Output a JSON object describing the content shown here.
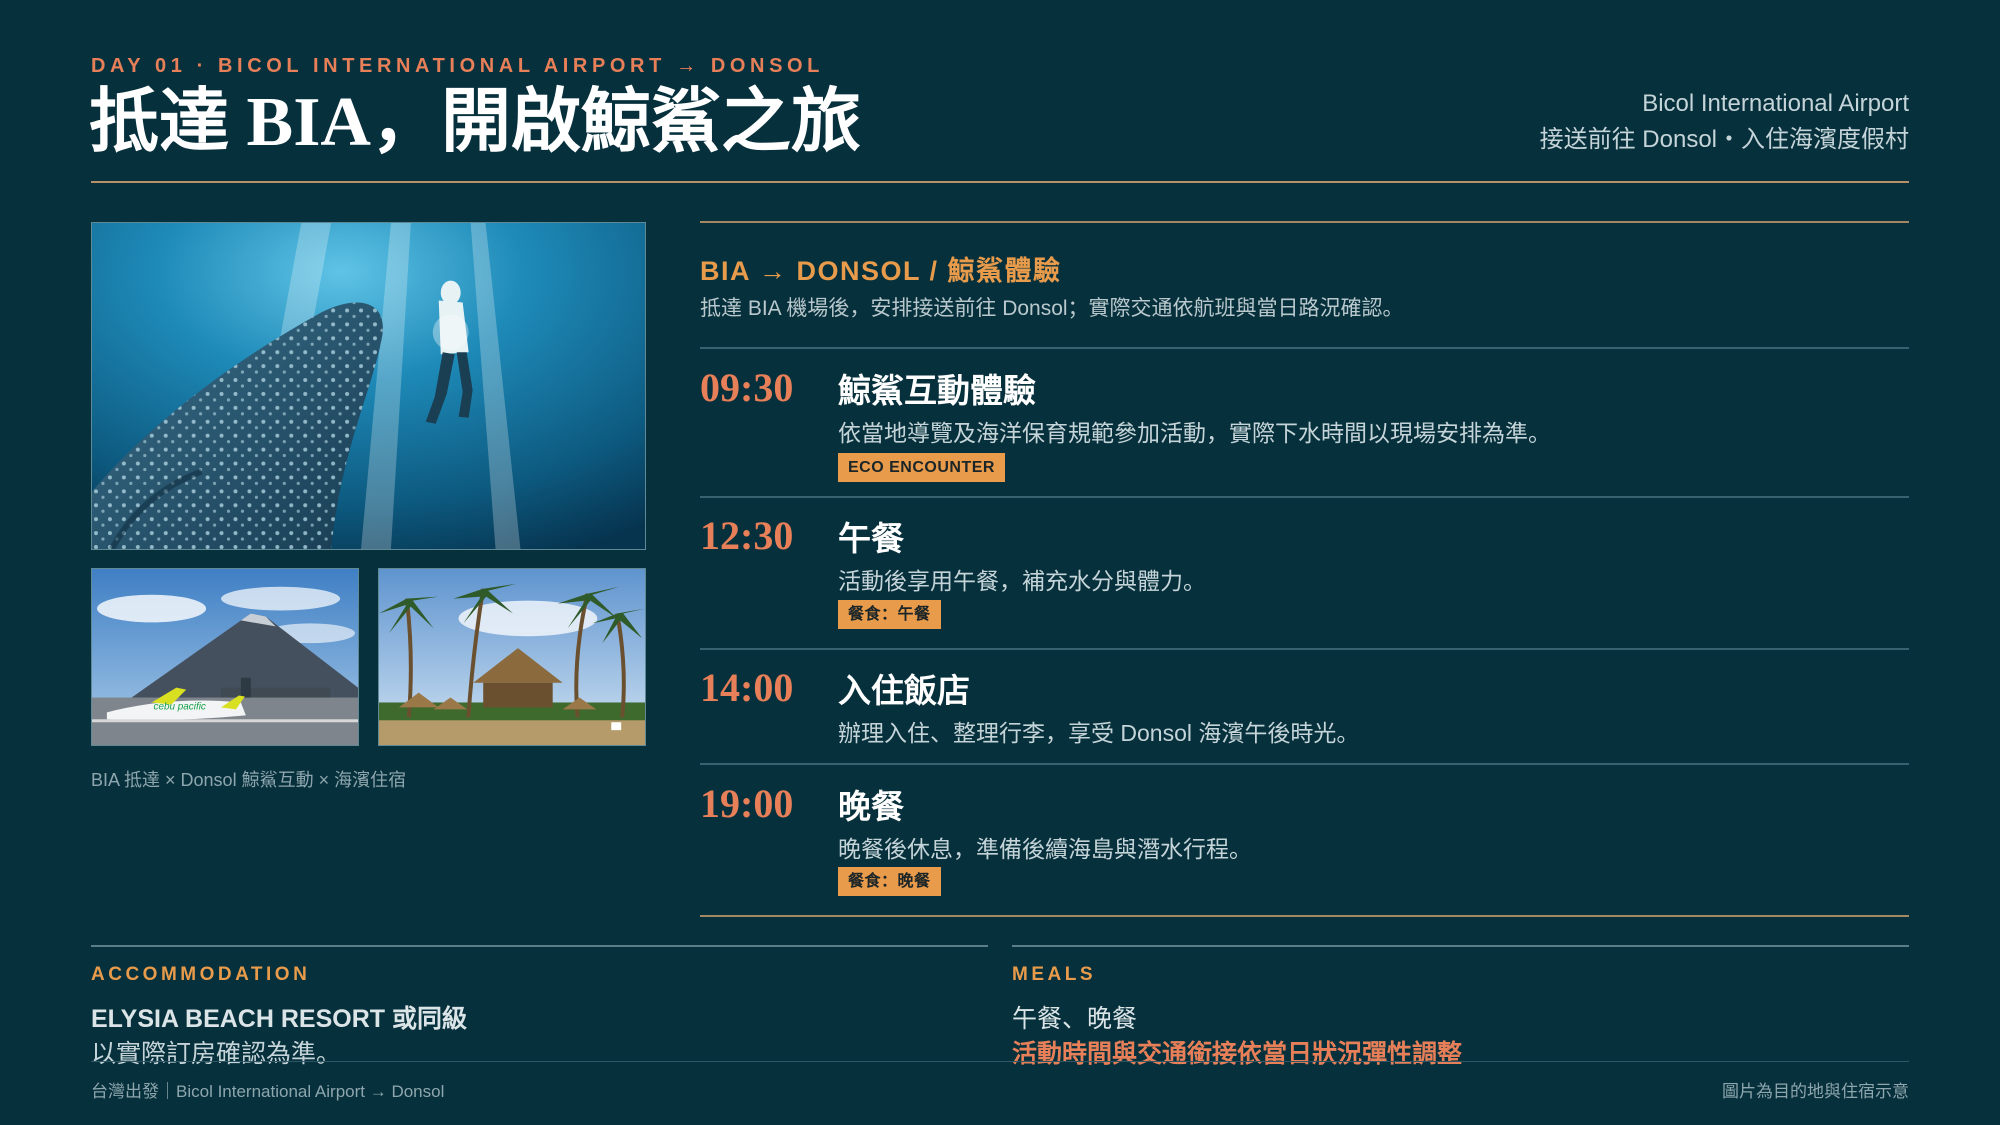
{
  "header": {
    "day_label": "DAY 01 · BICOL INTERNATIONAL AIRPORT → DONSOL",
    "title": "抵達 BIA，開啟鯨鯊之旅",
    "right_line1": "Bicol International Airport",
    "right_line2": "接送前往 Donsol・入住海濱度假村"
  },
  "photos": {
    "caption": "BIA 抵達 × Donsol 鯨鯊互動 × 海濱住宿",
    "airline_text": "cebu pacific"
  },
  "route": {
    "title": "BIA → DONSOL / 鯨鯊體驗",
    "desc": "抵達 BIA 機場後，安排接送前往 Donsol；實際交通依航班與當日路況確認。"
  },
  "schedule": [
    {
      "time": "09:30",
      "title": "鯨鯊互動體驗",
      "desc": "依當地導覽及海洋保育規範參加活動，實際下水時間以現場安排為準。",
      "tag": "ECO ENCOUNTER"
    },
    {
      "time": "12:30",
      "title": "午餐",
      "desc": "活動後享用午餐，補充水分與體力。",
      "tag": "餐食：午餐"
    },
    {
      "time": "14:00",
      "title": "入住飯店",
      "desc": "辦理入住、整理行李，享受 Donsol 海濱午後時光。",
      "tag": ""
    },
    {
      "time": "19:00",
      "title": "晚餐",
      "desc": "晚餐後休息，準備後續海島與潛水行程。",
      "tag": "餐食：晚餐"
    }
  ],
  "accommodation": {
    "label": "ACCOMMODATION",
    "name": "ELYSIA BEACH RESORT 或同級",
    "note": "以實際訂房確認為準。"
  },
  "meals": {
    "label": "MEALS",
    "value": "午餐、晚餐",
    "note": "活動時間與交通銜接依當日狀況彈性調整"
  },
  "footer": {
    "left": "台灣出發｜Bicol International Airport → Donsol",
    "right": "圖片為目的地與住宿示意"
  },
  "colors": {
    "background": "#06303c",
    "accent_orange": "#e77f58",
    "accent_gold": "#e89b4a",
    "rule_gold": "#b89066"
  }
}
